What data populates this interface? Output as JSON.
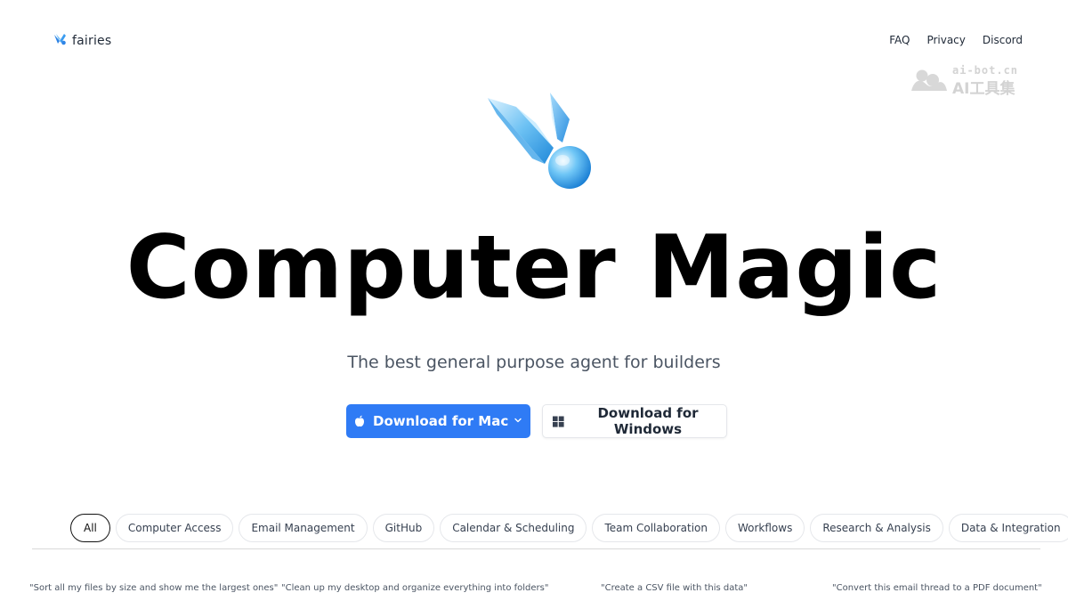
{
  "brand": {
    "name": "fairies"
  },
  "nav": {
    "items": [
      "FAQ",
      "Privacy",
      "Discord"
    ]
  },
  "watermark": {
    "line1": "ai-bot.cn",
    "line2": "AI工具集"
  },
  "hero": {
    "headline": "Computer Magic",
    "subtitle": "The best general purpose agent for builders"
  },
  "downloads": {
    "mac_label": "Download for Mac",
    "windows_label": "Download for Windows"
  },
  "tabs": [
    "All",
    "Computer Access",
    "Email Management",
    "GitHub",
    "Calendar & Scheduling",
    "Team Collaboration",
    "Workflows",
    "Research & Analysis",
    "Data & Integration"
  ],
  "active_tab": "All",
  "examples": [
    "\"Sort all my files by size and show me the largest ones\"",
    "\"Clean up my desktop and organize everything into folders\"",
    "\"Create a CSV file with this data\"",
    "\"Convert this email thread to a PDF document\""
  ],
  "colors": {
    "accent": "#2f7bf5",
    "text": "#111111",
    "muted": "#4b5563",
    "border": "#e5e7eb"
  },
  "icons": {
    "logo": "fairy-wing-icon",
    "mac": "apple-icon",
    "mac_dropdown": "chevron-down-icon",
    "windows": "windows-icon",
    "hero": "fairy-crystal-icon"
  }
}
